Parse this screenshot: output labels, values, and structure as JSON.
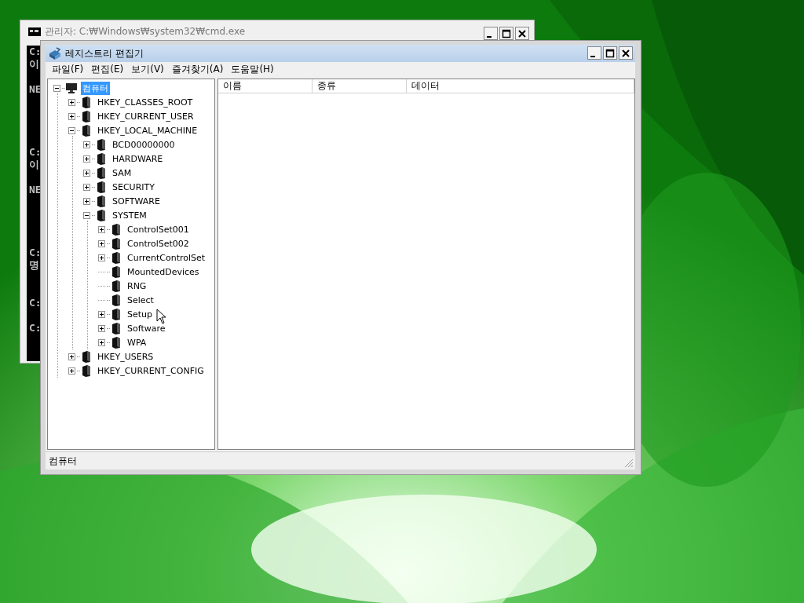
{
  "background_window": {
    "title": "관리자: C:₩Windows₩system32₩cmd.exe",
    "console_lines": [
      "C:",
      "이",
      "NE",
      "C:",
      "이",
      "NE",
      "C:",
      "명",
      "C:",
      "C:"
    ]
  },
  "window": {
    "title": "레지스트리 편집기"
  },
  "menu": [
    "파일(F)",
    "편집(E)",
    "보기(V)",
    "즐겨찾기(A)",
    "도움말(H)"
  ],
  "tree": [
    {
      "label": "컴퓨터",
      "kind": "computer",
      "selected": true,
      "expanded": true,
      "children": [
        {
          "label": "HKEY_CLASSES_ROOT",
          "kind": "key",
          "selected": false,
          "expanded": false,
          "has_children": true
        },
        {
          "label": "HKEY_CURRENT_USER",
          "kind": "key",
          "selected": false,
          "expanded": false,
          "has_children": true
        },
        {
          "label": "HKEY_LOCAL_MACHINE",
          "kind": "key",
          "selected": false,
          "expanded": true,
          "has_children": true,
          "children": [
            {
              "label": "BCD00000000",
              "kind": "key",
              "selected": false,
              "expanded": false,
              "has_children": true
            },
            {
              "label": "HARDWARE",
              "kind": "key",
              "selected": false,
              "expanded": false,
              "has_children": true
            },
            {
              "label": "SAM",
              "kind": "key",
              "selected": false,
              "expanded": false,
              "has_children": true
            },
            {
              "label": "SECURITY",
              "kind": "key",
              "selected": false,
              "expanded": false,
              "has_children": true
            },
            {
              "label": "SOFTWARE",
              "kind": "key",
              "selected": false,
              "expanded": false,
              "has_children": true
            },
            {
              "label": "SYSTEM",
              "kind": "key",
              "selected": false,
              "expanded": true,
              "has_children": true,
              "children": [
                {
                  "label": "ControlSet001",
                  "kind": "key",
                  "selected": false,
                  "expanded": false,
                  "has_children": true
                },
                {
                  "label": "ControlSet002",
                  "kind": "key",
                  "selected": false,
                  "expanded": false,
                  "has_children": true
                },
                {
                  "label": "CurrentControlSet",
                  "kind": "key",
                  "selected": false,
                  "expanded": false,
                  "has_children": true
                },
                {
                  "label": "MountedDevices",
                  "kind": "key",
                  "selected": false,
                  "has_children": false
                },
                {
                  "label": "RNG",
                  "kind": "key",
                  "selected": false,
                  "has_children": false
                },
                {
                  "label": "Select",
                  "kind": "key",
                  "selected": false,
                  "has_children": false
                },
                {
                  "label": "Setup",
                  "kind": "key",
                  "selected": false,
                  "expanded": false,
                  "has_children": true
                },
                {
                  "label": "Software",
                  "kind": "key",
                  "selected": false,
                  "expanded": false,
                  "has_children": true
                },
                {
                  "label": "WPA",
                  "kind": "key",
                  "selected": false,
                  "expanded": false,
                  "has_children": true
                }
              ]
            }
          ]
        },
        {
          "label": "HKEY_USERS",
          "kind": "key",
          "selected": false,
          "expanded": false,
          "has_children": true
        },
        {
          "label": "HKEY_CURRENT_CONFIG",
          "kind": "key",
          "selected": false,
          "expanded": false,
          "has_children": true
        }
      ]
    }
  ],
  "list": {
    "columns": [
      "이름",
      "종류",
      "데이터"
    ]
  },
  "status_bar": "컴퓨터"
}
